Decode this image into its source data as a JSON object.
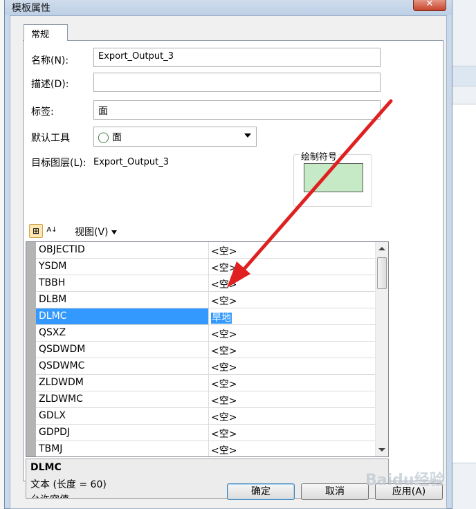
{
  "dialog": {
    "title": "模板属性",
    "close_glyph": "✕"
  },
  "tabs": [
    {
      "label": "常规"
    }
  ],
  "form": {
    "name_label": "名称(N):",
    "name_value": "Export_Output_3",
    "desc_label": "描述(D):",
    "desc_value": "",
    "tag_label": "标签:",
    "tag_value": "面",
    "tool_label": "默认工具",
    "tool_value": "面",
    "tool_icon": "polygon-tool-icon",
    "target_label": "目标图层(L):",
    "target_value": "Export_Output_3",
    "symbol_label": "绘制符号",
    "symbol_color": "#c6eac6"
  },
  "toolbar": {
    "view_label": "视图(V)",
    "categorized_glyph": "⊞",
    "sort_glyph": "A↓"
  },
  "grid": {
    "rows": [
      {
        "name": "OBJECTID",
        "value": "<空>"
      },
      {
        "name": "YSDM",
        "value": "<空>"
      },
      {
        "name": "TBBH",
        "value": "<空>"
      },
      {
        "name": "DLBM",
        "value": "<空>"
      },
      {
        "name": "DLMC",
        "value": "旱地",
        "selected": true
      },
      {
        "name": "QSXZ",
        "value": "<空>"
      },
      {
        "name": "QSDWDM",
        "value": "<空>"
      },
      {
        "name": "QSDWMC",
        "value": "<空>"
      },
      {
        "name": "ZLDWDM",
        "value": "<空>"
      },
      {
        "name": "ZLDWMC",
        "value": "<空>"
      },
      {
        "name": "GDLX",
        "value": "<空>"
      },
      {
        "name": "GDPDJ",
        "value": "<空>"
      },
      {
        "name": "TBMJ",
        "value": "<空>"
      }
    ]
  },
  "description": {
    "title": "DLMC",
    "line1": "文本 (长度 = 60)",
    "line2": "允许空值"
  },
  "buttons": {
    "ok": "确定",
    "cancel": "取消",
    "apply": "应用(A)"
  },
  "watermark": "Baidu经验",
  "colors": {
    "selection": "#3399ff",
    "annotation_arrow": "#e02020"
  }
}
